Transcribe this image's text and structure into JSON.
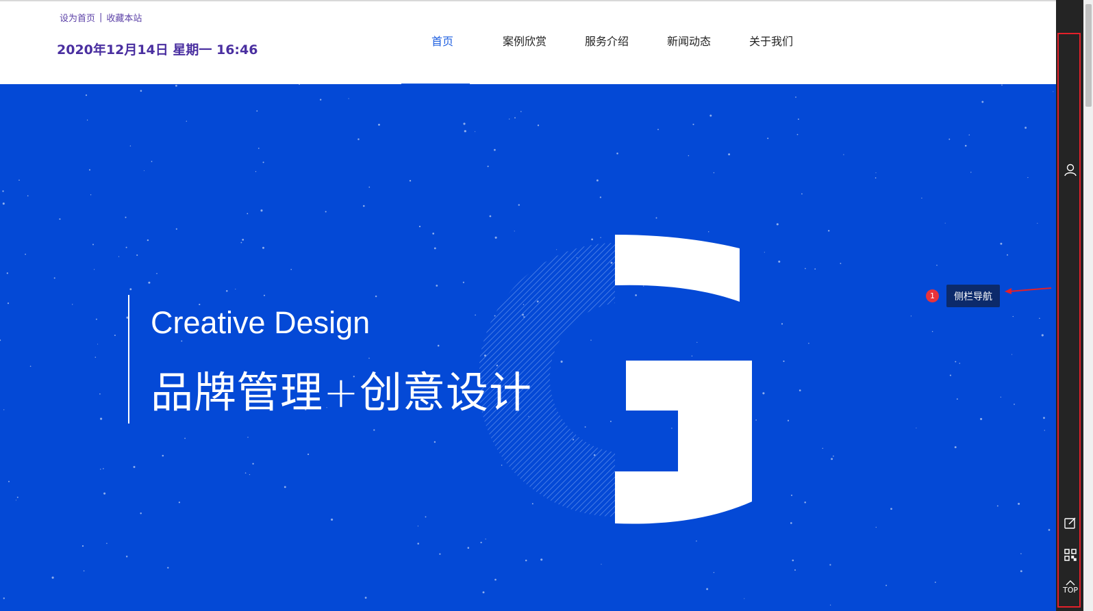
{
  "header": {
    "set_home": "设为首页",
    "separator": "|",
    "bookmark": "收藏本站",
    "datetime": "2020年12月14日 星期一 16:46"
  },
  "nav": {
    "items": [
      {
        "label": "首页",
        "active": true
      },
      {
        "label": "案例欣赏",
        "active": false
      },
      {
        "label": "服务介绍",
        "active": false
      },
      {
        "label": "新闻动态",
        "active": false
      },
      {
        "label": "关于我们",
        "active": false
      }
    ]
  },
  "hero": {
    "title_en": "Creative Design",
    "title_cn": "品牌管理+创意设计",
    "bg_color": "#0449d6"
  },
  "annotation": {
    "badge": "1",
    "label": "侧栏导航"
  },
  "sidebar": {
    "icons": [
      "user-icon",
      "edit-icon",
      "qrcode-icon",
      "top-icon"
    ],
    "top_label": "TOP"
  }
}
